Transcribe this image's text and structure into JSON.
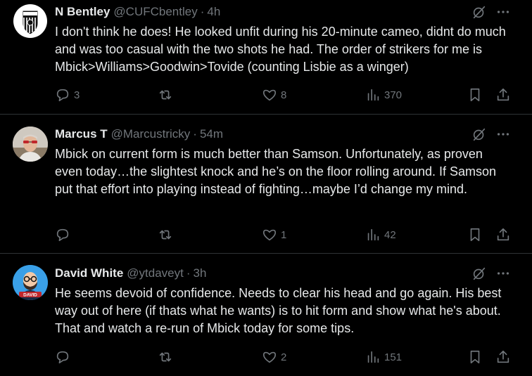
{
  "tweets": [
    {
      "name": "N Bentley",
      "handle": "@CUFCbentley",
      "time": "4h",
      "text": "I don't think he does! He looked unfit during his 20-minute cameo, didnt do much and was too casual with the two shots he had. The order of strikers for me is Mbick>Williams>Goodwin>Tovide (counting Lisbie as a winger)",
      "replies": "3",
      "reposts": "",
      "likes": "8",
      "views": "370",
      "avatar_icon": "club-crest-icon"
    },
    {
      "name": "Marcus T",
      "handle": "@Marcustricky",
      "time": "54m",
      "text": "Mbick on current form is much better than Samson. Unfortunately, as proven even today…the slightest knock and he’s on the floor rolling around. If Samson put that effort into playing instead of fighting…maybe I’d change my mind.",
      "replies": "",
      "reposts": "",
      "likes": "1",
      "views": "42",
      "avatar_icon": "person-photo"
    },
    {
      "name": "David White",
      "handle": "@ytdaveyt",
      "time": "3h",
      "text": "He seems devoid of confidence. Needs to clear his head and go again. His best way out of here (if thats what he wants) is to hit form and show what he's about. That and watch a re-run of Mbick today for some tips.",
      "replies": "",
      "reposts": "",
      "likes": "2",
      "views": "151",
      "avatar_icon": "cartoon-avatar",
      "avatar_label": "DAVID"
    }
  ],
  "colors": {
    "background": "#000000",
    "text": "#e7e9ea",
    "muted": "#71767b",
    "divider": "#2f3336"
  }
}
